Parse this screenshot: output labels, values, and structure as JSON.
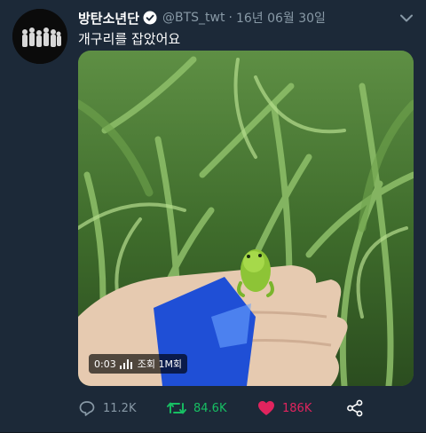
{
  "tweet": {
    "display_name": "방탄소년단",
    "handle": "@BTS_twt",
    "separator": "·",
    "date": "16년 06월 30일",
    "text": "개구리를 잡았어요"
  },
  "video": {
    "duration": "0:03",
    "views": "조회 1M회"
  },
  "actions": {
    "reply_count": "11.2K",
    "retweet_count": "84.6K",
    "like_count": "186K"
  },
  "colors": {
    "background": "#1c2938",
    "secondary_text": "#8899a6",
    "retweet": "#17bf63",
    "like": "#e0245e"
  },
  "icons": [
    "verified-icon",
    "chevron-down-icon",
    "reply-icon",
    "retweet-icon",
    "heart-icon",
    "share-icon"
  ]
}
